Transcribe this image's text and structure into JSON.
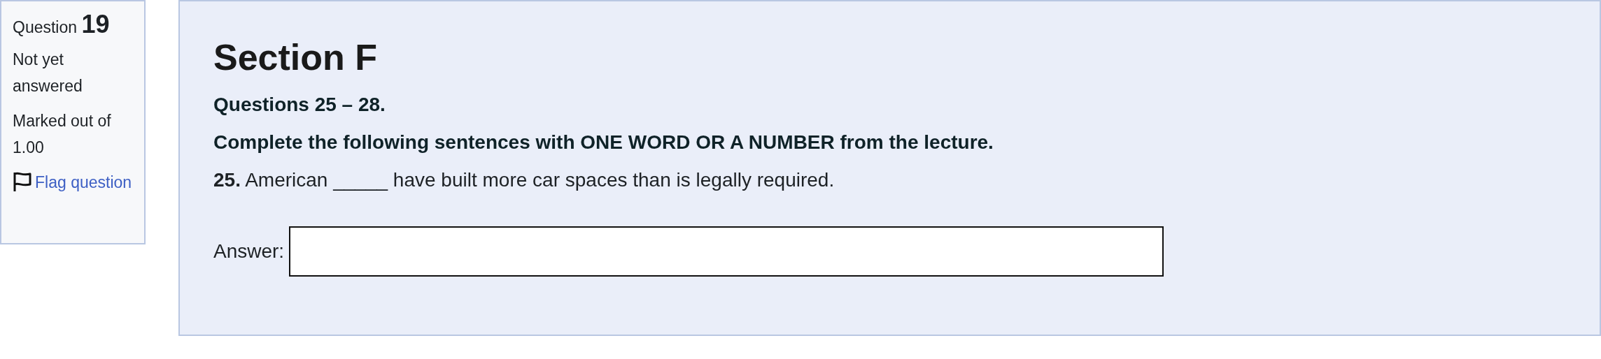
{
  "info": {
    "label": "Question",
    "number": "19",
    "status": "Not yet answered",
    "marks": "Marked out of 1.00",
    "flag": {
      "label": "Flag question",
      "flagged": false
    }
  },
  "content": {
    "heading": "Section F",
    "subheading": "Questions 25 – 28.",
    "instruction": "Complete the following sentences with ONE WORD OR A NUMBER from the lecture.",
    "question": "**25.** American _____ have built more car spaces than is legally required.",
    "answer": {
      "label": "Answer:"
    }
  }
}
